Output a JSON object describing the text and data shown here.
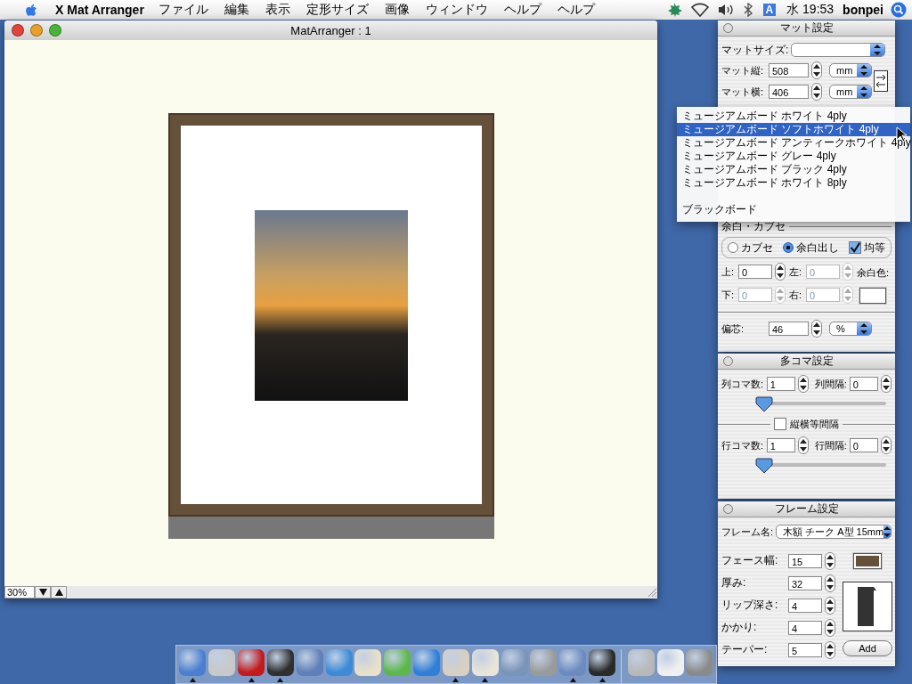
{
  "menubar": {
    "app_name": "X Mat Arranger",
    "menus": [
      "ファイル",
      "編集",
      "表示",
      "定形サイズ",
      "画像",
      "ウィンドウ",
      "ヘルプ",
      "ヘルプ"
    ],
    "input_menu": "A",
    "clock": "水 19:53",
    "user": "bonpei"
  },
  "main_window": {
    "title": "MatArranger : 1",
    "zoom": "30%"
  },
  "mat_panel": {
    "title": "マット設定",
    "size_label": "マットサイズ:",
    "height": {
      "label": "マット縦:",
      "value": "508",
      "unit": "mm"
    },
    "width": {
      "label": "マット横:",
      "value": "406",
      "unit": "mm"
    },
    "board_menu": [
      {
        "label": "ミュージアムボード ホワイト 4ply",
        "selected": false
      },
      {
        "label": "ミュージアムボード ソフトホワイト 4ply",
        "selected": true
      },
      {
        "label": "ミュージアムボード アンティークホワイト 4ply",
        "selected": false
      },
      {
        "label": "ミュージアムボード グレー 4ply",
        "selected": false
      },
      {
        "label": "ミュージアムボード ブラック 4ply",
        "selected": false
      },
      {
        "label": "ミュージアムボード ホワイト 8ply",
        "selected": false
      },
      {
        "label": "ブラックボード",
        "selected": false
      }
    ],
    "margin_section": "余白・カブセ",
    "modes": [
      {
        "label": "カブセ",
        "selected": false
      },
      {
        "label": "余白出し",
        "selected": true
      }
    ],
    "equal": {
      "label": "均等",
      "checked": true
    },
    "margins": [
      {
        "label": "上:",
        "value": "0",
        "disabled": false
      },
      {
        "label": "左:",
        "value": "0",
        "disabled": true
      },
      {
        "label": "下:",
        "value": "0",
        "disabled": true
      },
      {
        "label": "右:",
        "value": "0",
        "disabled": true
      }
    ],
    "margin_color_label": "余白色:",
    "offset": {
      "label": "偏芯:",
      "value": "46",
      "unit": "%"
    }
  },
  "grid_panel": {
    "title": "多コマ設定",
    "columns": {
      "count_label": "列コマ数:",
      "count": "1",
      "gap_label": "列間隔:",
      "gap": "0",
      "level": 0
    },
    "equal": {
      "label": "縦横等間隔",
      "checked": false
    },
    "rows": {
      "count_label": "行コマ数:",
      "count": "1",
      "gap_label": "行間隔:",
      "gap": "0",
      "level": 0
    }
  },
  "frame_panel": {
    "title": "フレーム設定",
    "name_label": "フレーム名:",
    "name": "木額 チーク A型 15mm",
    "fields": [
      {
        "label": "フェース幅:",
        "value": "15"
      },
      {
        "label": "厚み:",
        "value": "32"
      },
      {
        "label": "リップ深さ:",
        "value": "4"
      },
      {
        "label": "かかり:",
        "value": "4"
      },
      {
        "label": "テーパー:",
        "value": "5"
      }
    ],
    "add_button": "Add"
  },
  "dock": {
    "apps": [
      {
        "running": true
      },
      {
        "running": false
      },
      {
        "running": true
      },
      {
        "running": true
      },
      {
        "running": false
      },
      {
        "running": false
      },
      {
        "running": false
      },
      {
        "running": false
      },
      {
        "running": false
      },
      {
        "running": true
      },
      {
        "running": true
      },
      {
        "running": false
      },
      {
        "running": false
      },
      {
        "running": true
      },
      {
        "running": true
      }
    ],
    "others": [
      {
        "running": false
      },
      {
        "running": false
      },
      {
        "running": false
      }
    ]
  }
}
